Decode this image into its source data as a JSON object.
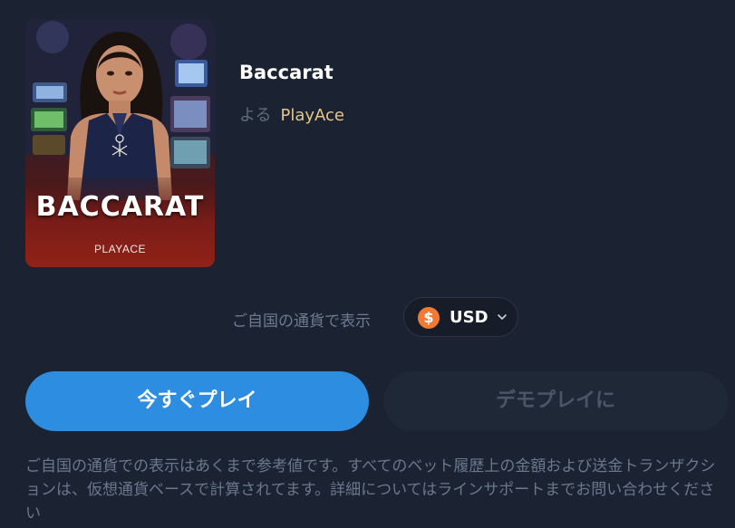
{
  "game": {
    "thumbnail": {
      "title": "BACCARAT",
      "provider": "PLAYACE"
    },
    "title": "Baccarat",
    "by_label": "よる",
    "provider": "PlayAce"
  },
  "currency": {
    "label": "ご自国の通貨で表示",
    "selected": "USD",
    "coin_symbol": "$",
    "coin_color": "#f07a33"
  },
  "buttons": {
    "play_now": "今すぐプレイ",
    "demo_play": "デモプレイに"
  },
  "colors": {
    "primary": "#2d8de0",
    "accent_gold": "#e4c58b",
    "background": "#1b2332"
  },
  "disclaimer": "ご自国の通貨での表示はあくまで参考値です。すべてのベット履歴上の金額および送金トランザクションは、仮想通貨ベースで計算されてます。詳細についてはラインサポートまでお問い合わせください"
}
